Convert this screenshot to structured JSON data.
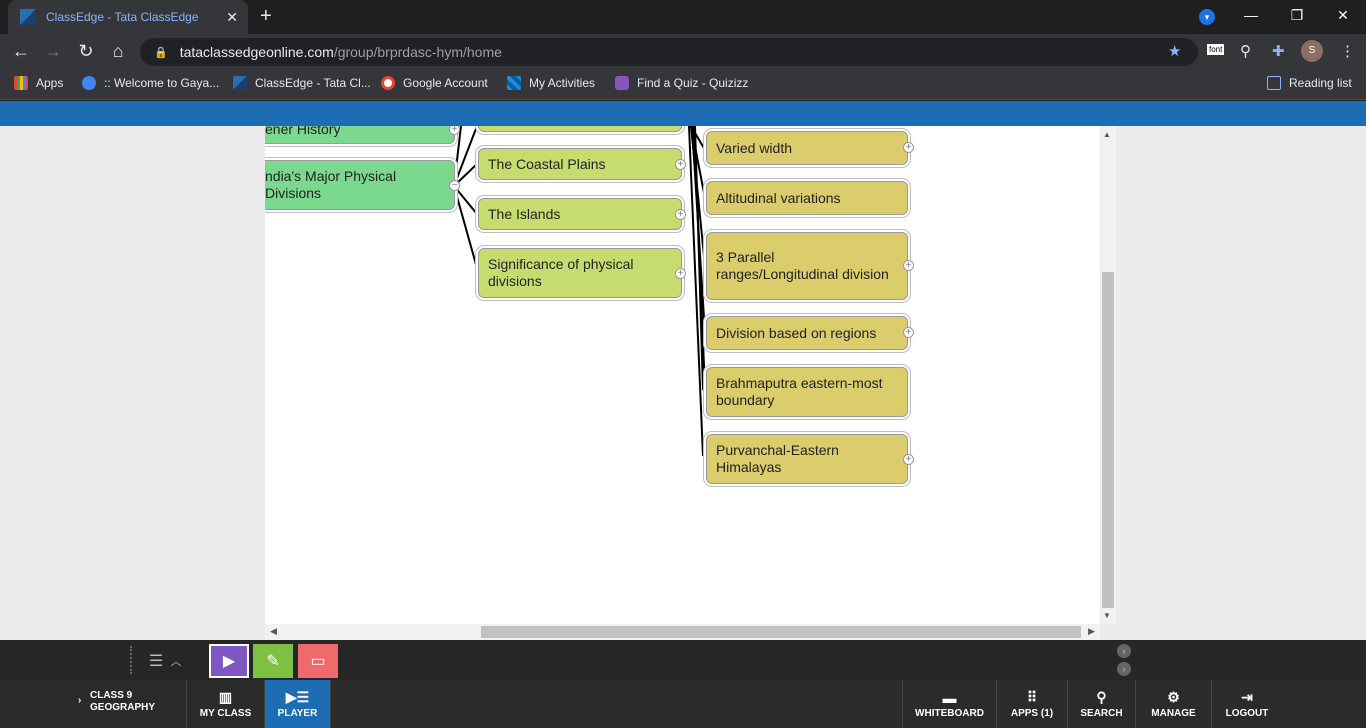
{
  "browser": {
    "tab_title": "ClassEdge - Tata ClassEdge",
    "tab_close": "✕",
    "new_tab": "+",
    "url_host": "tataclassedgeonline.com",
    "url_path": "/group/brprdasc-hym/home",
    "profile_initial": "S",
    "ext_font_label": "font",
    "bookmarks": [
      {
        "label": "Apps",
        "color": "#e94235"
      },
      {
        "label": ":: Welcome to Gaya...",
        "color": "#4285f4"
      },
      {
        "label": "ClassEdge - Tata Cl...",
        "color": "#2a6db5"
      },
      {
        "label": "Google Account",
        "color": "#ffffff"
      },
      {
        "label": "My Activities",
        "color": "#1a8fd8"
      },
      {
        "label": "Find a Quiz - Quizizz",
        "color": "#8854c0"
      }
    ],
    "reading_list": "Reading list"
  },
  "mindmap": {
    "root_nodes": [
      {
        "label": "ener History"
      },
      {
        "label": "ndia's Major Physical Divisions"
      }
    ],
    "mid_nodes": [
      {
        "label": "The Coastal Plains"
      },
      {
        "label": "The Islands"
      },
      {
        "label": "Significance of physical divisions"
      }
    ],
    "leaf_nodes": [
      {
        "label": "Varied width"
      },
      {
        "label": "Altitudinal variations"
      },
      {
        "label": "3 Parallel ranges/Longitudinal division"
      },
      {
        "label": "Division based on regions"
      },
      {
        "label": "Brahmaputra eastern-most boundary"
      },
      {
        "label": "Purvanchal-Eastern Himalayas"
      }
    ],
    "colors": {
      "root": "#7bd98f",
      "mid": "#c7dc6f",
      "leaf": "#dccd6c"
    }
  },
  "footer": {
    "class_line1": "CLASS 9",
    "class_line2": "GEOGRAPHY",
    "items": [
      {
        "label": "MY CLASS",
        "icon": "books-icon"
      },
      {
        "label": "PLAYER",
        "icon": "list-play-icon"
      },
      {
        "label": "WHITEBOARD",
        "icon": "whiteboard-icon"
      },
      {
        "label": "APPS (1)",
        "icon": "grid-icon"
      },
      {
        "label": "SEARCH",
        "icon": "search-icon"
      },
      {
        "label": "MANAGE",
        "icon": "manage-icon"
      },
      {
        "label": "LOGOUT",
        "icon": "logout-icon"
      }
    ],
    "active_color": "#1d6db5"
  }
}
